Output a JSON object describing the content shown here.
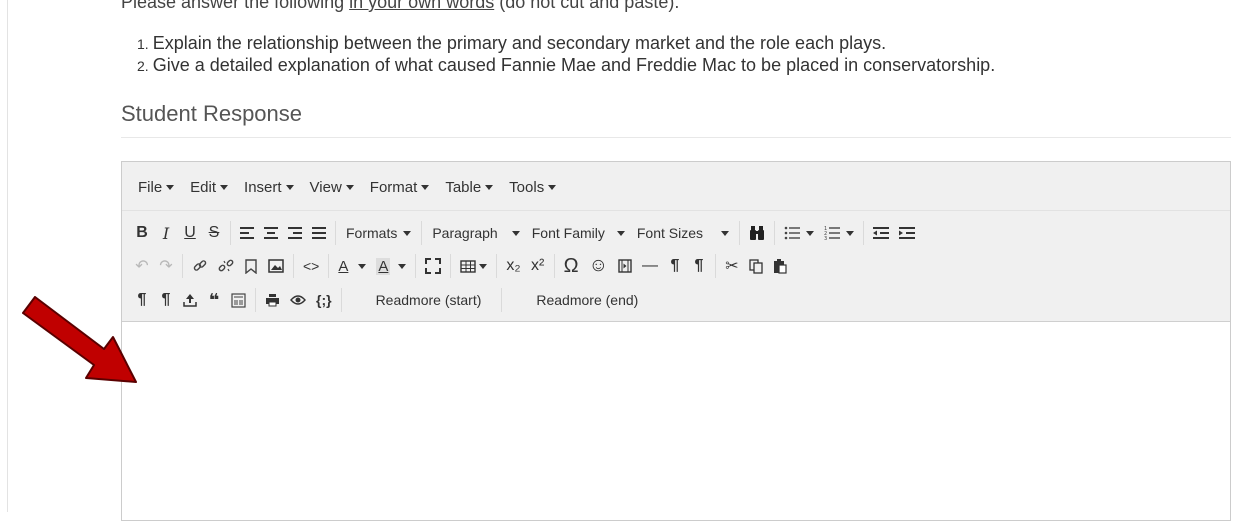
{
  "instructions": {
    "prefix": "Please answer the following ",
    "underlined": "in your own words",
    "suffix": " (do not cut and paste)."
  },
  "questions": [
    {
      "num": "1.",
      "text": "Explain the relationship between the primary and secondary market and the role each plays."
    },
    {
      "num": "2.",
      "text": "Give a detailed explanation of what caused Fannie Mae and Freddie Mac to be placed in conservatorship."
    }
  ],
  "section_title": "Student Response",
  "menubar": [
    "File",
    "Edit",
    "Insert",
    "View",
    "Format",
    "Table",
    "Tools"
  ],
  "toolbar": {
    "formats_label": "Formats",
    "paragraph_label": "Paragraph",
    "font_family_label": "Font Family",
    "font_sizes_label": "Font Sizes",
    "readmore_start": "Readmore (start)",
    "readmore_end": "Readmore (end)"
  },
  "icons": {
    "bold": "B",
    "italic": "I",
    "underline": "U",
    "strike": "S",
    "align_left": "≡",
    "align_center": "≡",
    "align_right": "≡",
    "justify": "≡",
    "find": "binoculars-icon",
    "bullet_list": "☰",
    "num_list": "☷",
    "undo": "↶",
    "redo": "↷",
    "link": "link-icon",
    "unlink": "unlink-icon",
    "bookmark": "bookmark-icon",
    "image": "image-icon",
    "code": "<>",
    "text_color": "A",
    "bg_color": "A",
    "fullscreen": "fullscreen-icon",
    "table": "table-icon",
    "subscript": "x₂",
    "superscript": "x²",
    "special_char": "Ω",
    "emoticon": "☺",
    "media": "media-icon",
    "hr": "—",
    "ltr": "¶",
    "rtl": "¶",
    "cut": "✂",
    "copy": "copy-icon",
    "paste": "paste-icon",
    "pilcrow1": "¶",
    "pilcrow2": "¶",
    "upload": "upload-icon",
    "quote": "❝",
    "template": "template-icon",
    "print": "print-icon",
    "preview": "eye-icon",
    "source": "{;}"
  },
  "colors": {
    "arrow": "#c00000",
    "toolbar_bg": "#f0f0f0"
  }
}
